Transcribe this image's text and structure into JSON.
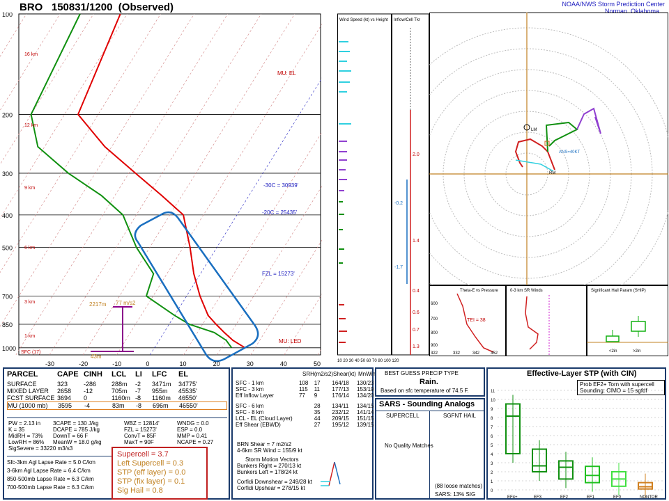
{
  "header": {
    "station": "BRO",
    "time": "150831/1200",
    "obs": "(Observed)",
    "agency": "NOAA/NWS Storm Prediction Center",
    "city": "Norman, Oklahoma"
  },
  "skewt": {
    "pressure_ticks": [
      "100",
      "200",
      "300",
      "400",
      "500",
      "700",
      "850",
      "1000"
    ],
    "temp_ticks": [
      "-30",
      "-20",
      "-10",
      "0",
      "10",
      "20",
      "30",
      "40",
      "50"
    ],
    "height_marks": [
      "16 km",
      "12 km",
      "9 km",
      "6 km",
      "3 km",
      "1 km",
      "SFC (17)"
    ],
    "annotations": {
      "mu_el": "MU: EL",
      "m30": "-30C = 30939'",
      "m20": "-20C = 25435'",
      "fzl": "FZL = 15273'",
      "mu_led": "MU: LED",
      "dcape_top": "2217m",
      "dcape_mid": "77 m/s2",
      "dcape_bot": "43m"
    },
    "colors": {
      "temp": "#e00000",
      "dewp": "#109010",
      "box": "#1a6fc0"
    }
  },
  "wind_panel": {
    "title": "Wind Speed (kt) vs Height",
    "xaxis": "10 20 30 40 50 60 70 80 100 120"
  },
  "inflow_panel": {
    "title": "Inflow/Cell Tkr",
    "labels": [
      "2.0",
      "-0.2",
      "1.4",
      "-1.7",
      "0.4",
      "0.6",
      "0.7",
      "1.3"
    ]
  },
  "hodograph": {
    "ticks": [
      "80",
      "70",
      "60",
      "50",
      "40",
      "30",
      "20",
      "10",
      "10",
      "20",
      "30",
      "40",
      "50",
      "60",
      "70",
      "80"
    ],
    "labels": {
      "rm": "RM",
      "lm": "LM",
      "mean": "ANS=40KT"
    }
  },
  "theta_panel": {
    "title": "Theta-E vs Pressure",
    "tei": "TEI = 38",
    "y": [
      "600",
      "700",
      "800",
      "900"
    ],
    "x": [
      "322",
      "332",
      "342",
      "352"
    ]
  },
  "srh_panel": {
    "title": "0-3 km SR Winds"
  },
  "sig_panel": {
    "title": "Significant Hail Param (SHIP)",
    "labels": [
      "<2in",
      ">2in"
    ]
  },
  "parcel_table": {
    "headers": [
      "PARCEL",
      "CAPE",
      "CINH",
      "LCL",
      "LI",
      "LFC",
      "EL"
    ],
    "rows": [
      [
        "SURFACE",
        "323",
        "-286",
        "288m",
        "-2",
        "3471m",
        "34775'"
      ],
      [
        "MIXED LAYER",
        "2658",
        "-12",
        "705m",
        "-7",
        "955m",
        "45535'"
      ],
      [
        "FCST SURFACE",
        "3694",
        "0",
        "1160m",
        "-8",
        "1160m",
        "46550'"
      ],
      [
        "MU (1000 mb)",
        "3595",
        "-4",
        "83m",
        "-8",
        "696m",
        "46550'"
      ]
    ],
    "lines": [
      "PW = 2.13 in",
      "K = 35",
      "MidRH = 73%",
      "LowRH = 86%",
      "SigSevere = 33220 m3/s3"
    ],
    "lines2": [
      "3CAPE = 130 J/kg",
      "DCAPE = 785 J/kg",
      "DownT = 66 F",
      "MeanW = 18.0 g/kg"
    ],
    "lines3": [
      "WBZ = 12814'",
      "FZL = 15273'",
      "ConvT = 85F",
      "MaxT = 90F"
    ],
    "lines4": [
      "WNDG = 0.0",
      "ESP = 0.0",
      "MMP = 0.41",
      "NCAPE = 0.27"
    ],
    "lapse": [
      "Sfc-3km Agl Lapse Rate = 5.0 C/km",
      "3-6km Agl Lapse Rate = 6.4 C/km",
      "850-500mb Lapse Rate = 6.3 C/km",
      "700-500mb Lapse Rate = 6.3 C/km"
    ]
  },
  "params_box": {
    "items": [
      "Supercell = 3.7",
      "Left Supercell = 0.3",
      "STP (eff layer) = 0.0",
      "STP (fix layer) = 0.1",
      "Sig Hail = 0.8"
    ]
  },
  "kinematics": {
    "headers": [
      "SRH(m2/s2)",
      "Shear(kt)",
      "MnWind",
      "SRW"
    ],
    "rows": [
      [
        "SFC - 1 km",
        "108",
        "17",
        "164/18",
        "130/23"
      ],
      [
        "SFC - 3 km",
        "115",
        "11",
        "177/13",
        "153/19"
      ],
      [
        "Eff Inflow Layer",
        "77",
        "9",
        "176/14",
        "134/20"
      ],
      [
        "SFC - 6 km",
        "",
        "28",
        "134/11",
        "134/15"
      ],
      [
        "SFC - 8 km",
        "",
        "35",
        "232/12",
        "141/14"
      ],
      [
        "LCL - EL (Cloud Layer)",
        "",
        "44",
        "209/15",
        "151/15"
      ],
      [
        "Eff Shear (EBWD)",
        "",
        "27",
        "195/12",
        "139/15"
      ]
    ],
    "brn": [
      "BRN Shear = 7 m2/s2",
      "4-6km SR Wind = 155/9 kt"
    ],
    "smv": [
      "Storm Motion Vectors",
      "Bunkers Right = 270/13 kt",
      "Bunkers Left = 178/24 kt",
      "Corfidi Downshear = 249/28 kt",
      "Corfidi Upshear = 278/15 kt"
    ]
  },
  "precip": {
    "title": "BEST GUESS PRECIP TYPE",
    "value": "Rain.",
    "note": "Based on sfc temperature of 74.5 F."
  },
  "sars": {
    "title": "SARS - Sounding Analogs",
    "col1": "SUPERCELL",
    "col2": "SGFNT HAIL",
    "no_match": "No Quality Matches",
    "matches": "(88 loose matches)",
    "sig": "SARS: 13% SIG"
  },
  "stp": {
    "title": "Effective-Layer STP (with CIN)",
    "legend": [
      "Prob EF2+ Torn with supercell",
      "Sounding: CIMO = 15 sgfdf"
    ],
    "y": [
      "11",
      "10",
      "9",
      "8",
      "7",
      "6",
      "5",
      "4",
      "3",
      "2",
      "1",
      "0"
    ],
    "cats": [
      "EF4+",
      "EF3",
      "EF2",
      "EF1",
      "EF0",
      "NONTOR"
    ]
  },
  "chart_data": {
    "type": "line",
    "title": "BRO 150831/1200 (Observed)",
    "xlabel": "",
    "ylabel": "",
    "xlim": [
      -30,
      50
    ],
    "ylim": [
      1050,
      100
    ],
    "series": [
      {
        "name": "temperature",
        "x": [
          27,
          22,
          18,
          14,
          10,
          4,
          -2,
          -8,
          -16,
          -26,
          -38,
          -52,
          -66,
          -72
        ],
        "y": [
          1000,
          950,
          900,
          850,
          800,
          700,
          600,
          500,
          400,
          350,
          300,
          250,
          200,
          100
        ]
      },
      {
        "name": "dewpoint",
        "x": [
          23,
          20,
          15,
          6,
          0,
          -12,
          -14,
          -24,
          -34,
          -44,
          -58,
          -72,
          -80,
          -84
        ],
        "y": [
          1000,
          950,
          900,
          850,
          800,
          700,
          600,
          500,
          400,
          350,
          300,
          250,
          200,
          100
        ]
      }
    ]
  }
}
